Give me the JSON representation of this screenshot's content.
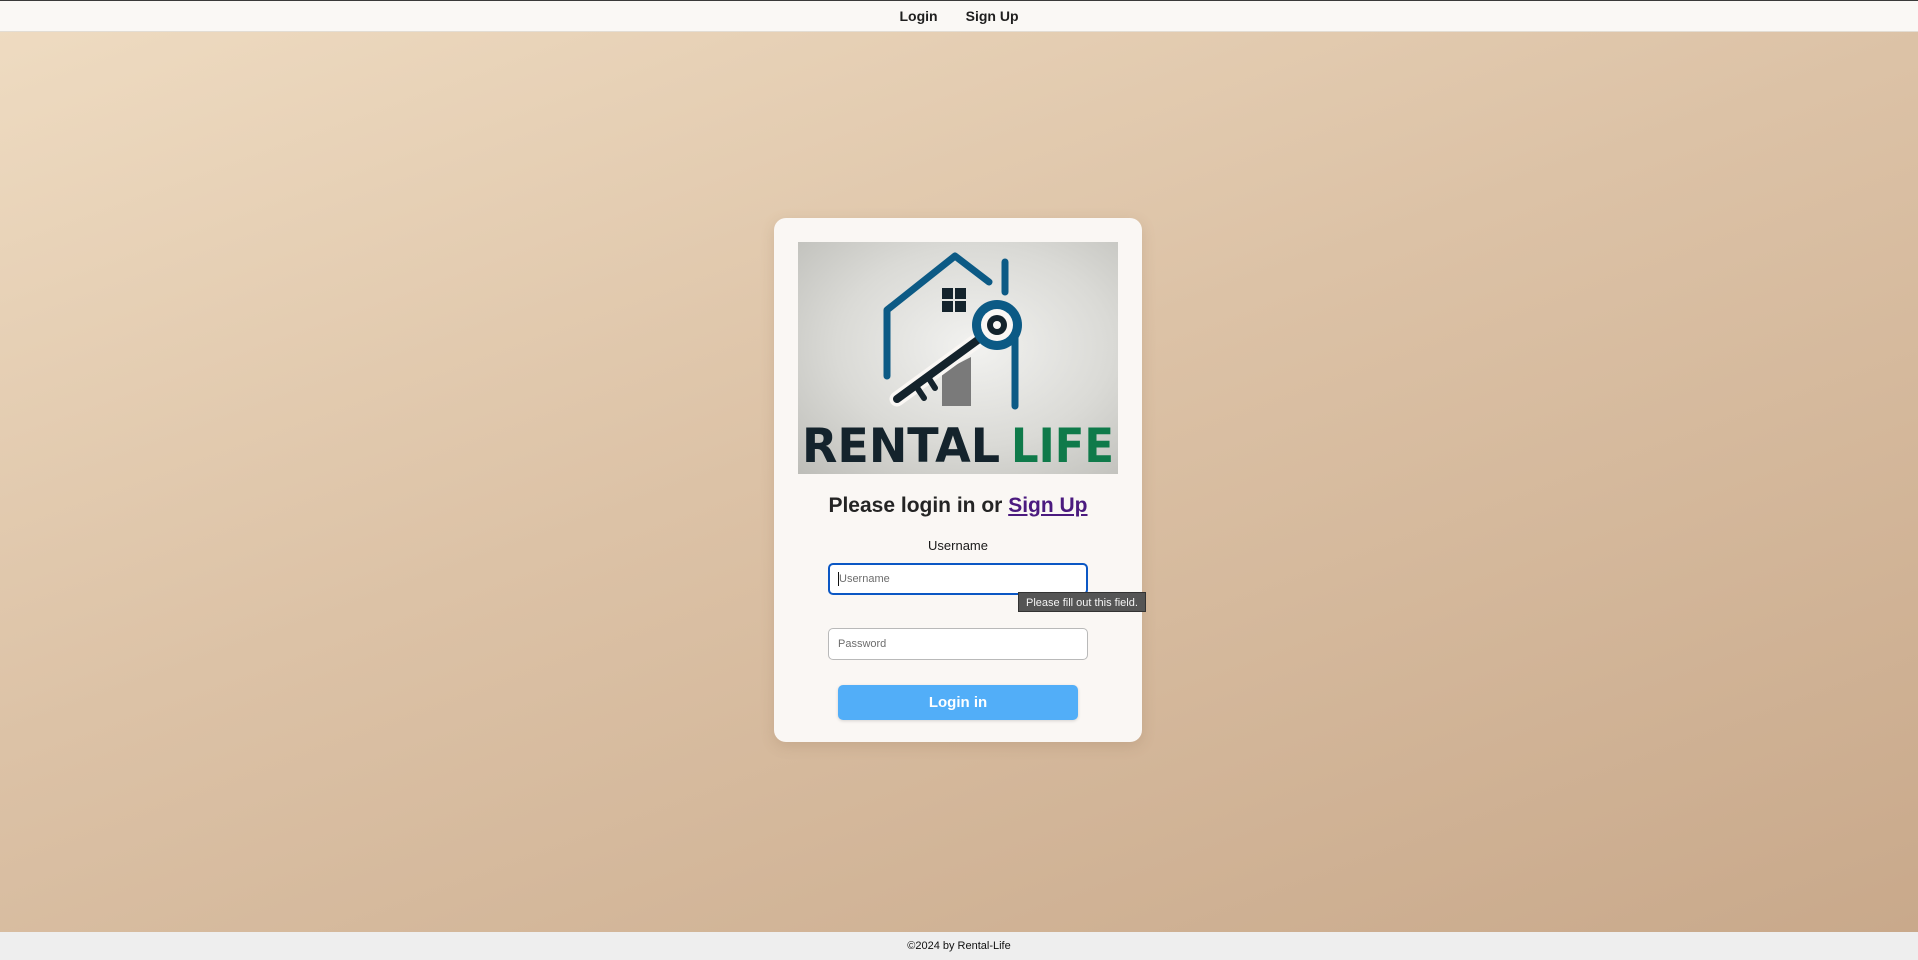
{
  "nav": {
    "login_label": "Login",
    "signup_label": "Sign Up"
  },
  "logo": {
    "word_dark": "RENTAL",
    "word_green": "LIFE",
    "dark_color": "#14232c",
    "green_color": "#0f7a4a",
    "house_color": "#0c5a85"
  },
  "form": {
    "heading_prefix": "Please login in or ",
    "heading_link": "Sign Up",
    "username_label": "Username",
    "username_placeholder": "Username",
    "password_placeholder": "Password",
    "submit_label": "Login in",
    "validation_tooltip": "Please fill out this field."
  },
  "footer": {
    "text": "©2024 by Rental-Life"
  },
  "colors": {
    "button": "#52aef8",
    "focus_border": "#0b57c4",
    "link": "#4b1a7f"
  }
}
